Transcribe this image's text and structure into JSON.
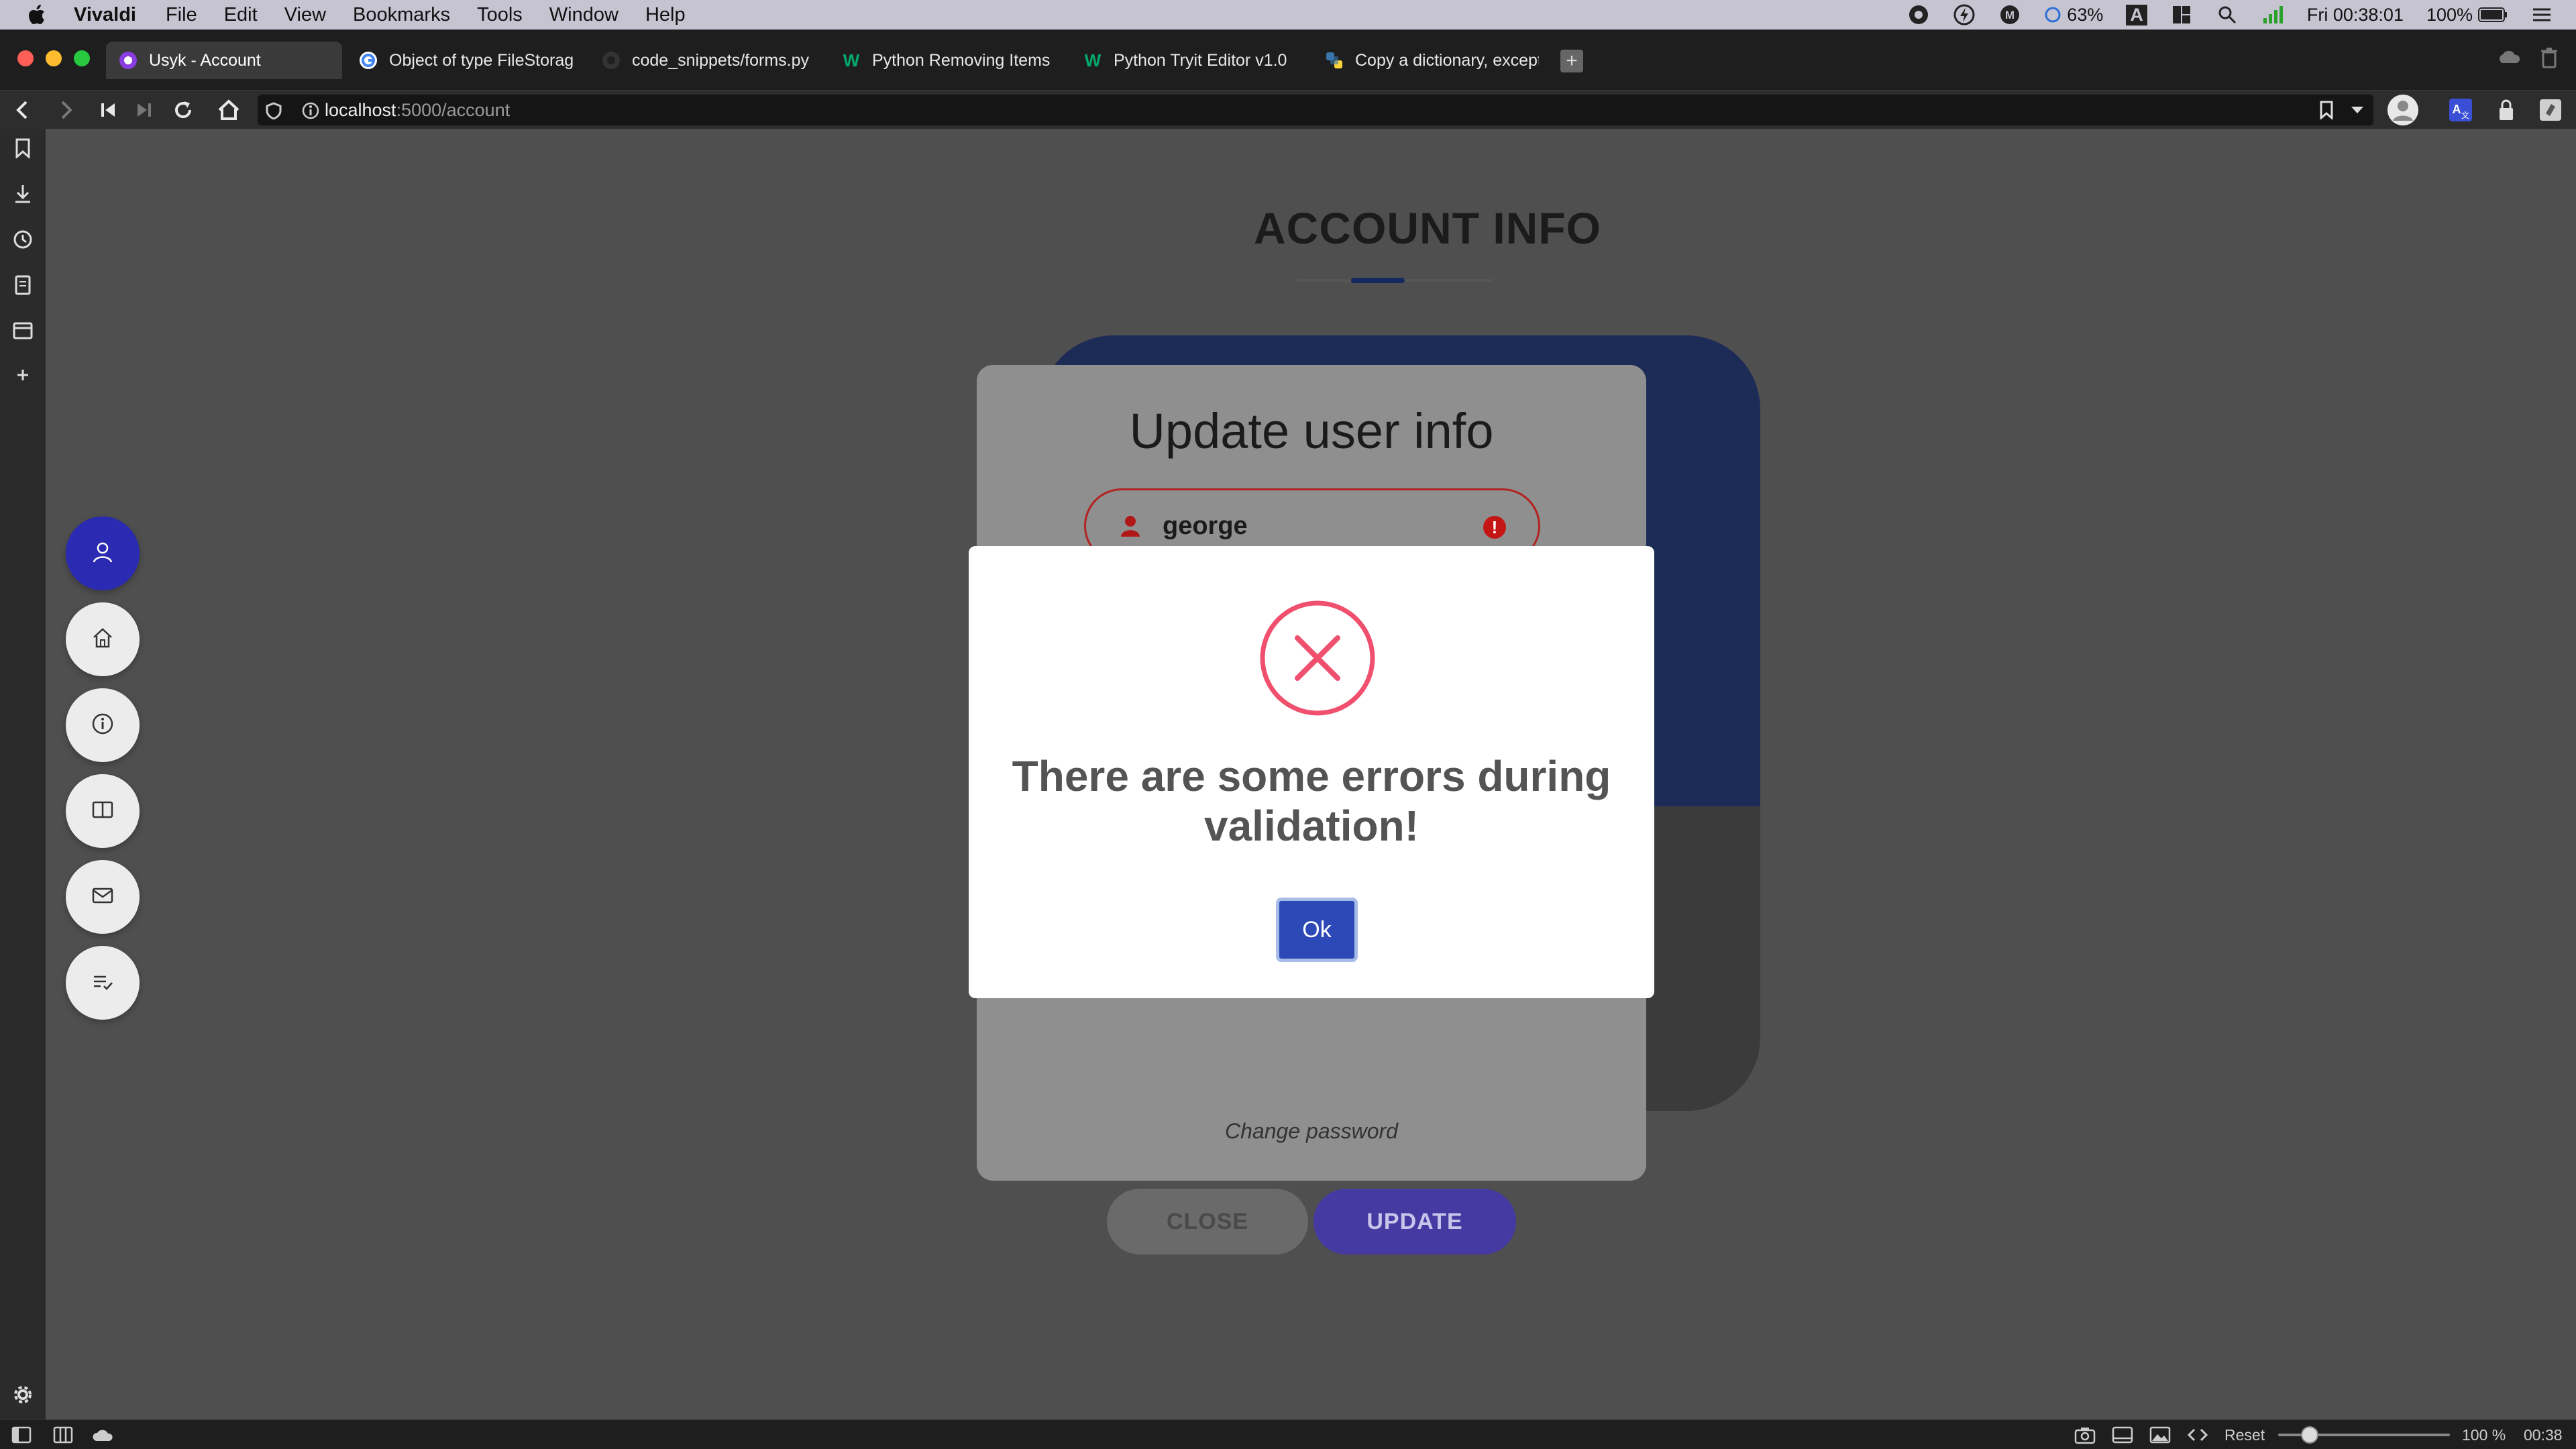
{
  "menubar": {
    "app_name": "Vivaldi",
    "menus": [
      "File",
      "Edit",
      "View",
      "Bookmarks",
      "Tools",
      "Window",
      "Help"
    ],
    "battery_cpu": "63%",
    "keyboard_layout": "A",
    "clock": "Fri 00:38:01",
    "battery": "100%"
  },
  "tabs": [
    {
      "title": "Usyk - Account",
      "favicon": "usyk-icon"
    },
    {
      "title": "Object of type FileStorage",
      "favicon": "google-icon"
    },
    {
      "title": "code_snippets/forms.py at",
      "favicon": "github-icon"
    },
    {
      "title": "Python Removing Items fr",
      "favicon": "w3schools-icon"
    },
    {
      "title": "Python Tryit Editor v1.0",
      "favicon": "w3schools-icon"
    },
    {
      "title": "Copy a dictionary, except",
      "favicon": "python-icon"
    }
  ],
  "addressbar": {
    "host": "localhost",
    "path": ":5000/account"
  },
  "page": {
    "heading": "ACCOUNT INFO",
    "form": {
      "title": "Update user info",
      "username_value": "george",
      "change_password": "Change password",
      "close_label": "CLOSE",
      "update_label": "UPDATE"
    },
    "side_nav": [
      "user-icon",
      "home-icon",
      "info-icon",
      "book-icon",
      "mail-icon",
      "list-check-icon"
    ]
  },
  "modal": {
    "message": "There are some errors during validation!",
    "ok_label": "Ok",
    "icon": "error-x-icon",
    "icon_color": "#f0506e"
  },
  "statusbar": {
    "reset_label": "Reset",
    "zoom": "100 %",
    "time": "00:38"
  },
  "colors": {
    "accent": "#2b2ab2",
    "error": "#c51616",
    "ok_button": "#2d49b8"
  }
}
